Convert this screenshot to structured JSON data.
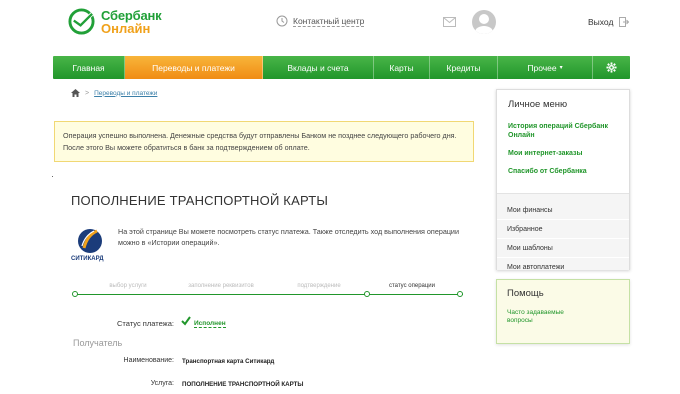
{
  "brand": {
    "line1": "Сбербанк",
    "line2": "Онлайн",
    "green": "#21a038",
    "orange": "#f0a11b"
  },
  "header": {
    "contact_label": "Контактный центр",
    "logout_label": "Выход"
  },
  "nav": {
    "items": [
      {
        "label": "Главная",
        "active": false
      },
      {
        "label": "Переводы и платежи",
        "active": true
      },
      {
        "label": "Вклады и счета",
        "active": false
      },
      {
        "label": "Карты",
        "active": false
      },
      {
        "label": "Кредиты",
        "active": false
      },
      {
        "label": "Прочее",
        "active": false
      },
      {
        "label": "",
        "icon": "gear-icon",
        "active": false
      }
    ],
    "more_caret": "▾"
  },
  "breadcrumb": {
    "home_icon": "home-icon",
    "separator": ">",
    "current": "Переводы и платежи"
  },
  "notice": {
    "text": "Операция успешно выполнена. Денежные средства будут отправлены Банком не позднее следующего рабочего дня. После этого Вы можете обратиться в банк за подтверждением об оплате."
  },
  "page": {
    "title": "ПОПОЛНЕНИЕ ТРАНСПОРТНОЙ КАРТЫ",
    "provider_name": "СИТИКАРД",
    "info": "На этой странице Вы можете посмотреть статус платежа. Также отследить ход выполнения операции можно в «Истории операций»."
  },
  "steps": {
    "labels": [
      "выбор услуги",
      "заполнение реквизитов",
      "подтверждение",
      "статус операции"
    ],
    "current_index": 3
  },
  "status": {
    "label": "Статус платежа:",
    "value": "Исполнен",
    "icon": "check-icon"
  },
  "recipient": {
    "heading": "Получатель",
    "name_label": "Наименование:",
    "name_value": "Транспортная карта Ситикард",
    "service_label": "Услуга:",
    "service_value": "ПОПОЛНЕНИЕ ТРАНСПОРТНОЙ КАРТЫ"
  },
  "personal_menu": {
    "title": "Личное меню",
    "links": [
      "История операций Сбербанк Онлайн",
      "Мои интернет-заказы",
      "Спасибо от Сбербанка"
    ],
    "items": [
      "Мои финансы",
      "Избранное",
      "Мои шаблоны",
      "Мои автоплатежи"
    ]
  },
  "help": {
    "title": "Помощь",
    "link": "Часто задаваемые вопросы"
  }
}
